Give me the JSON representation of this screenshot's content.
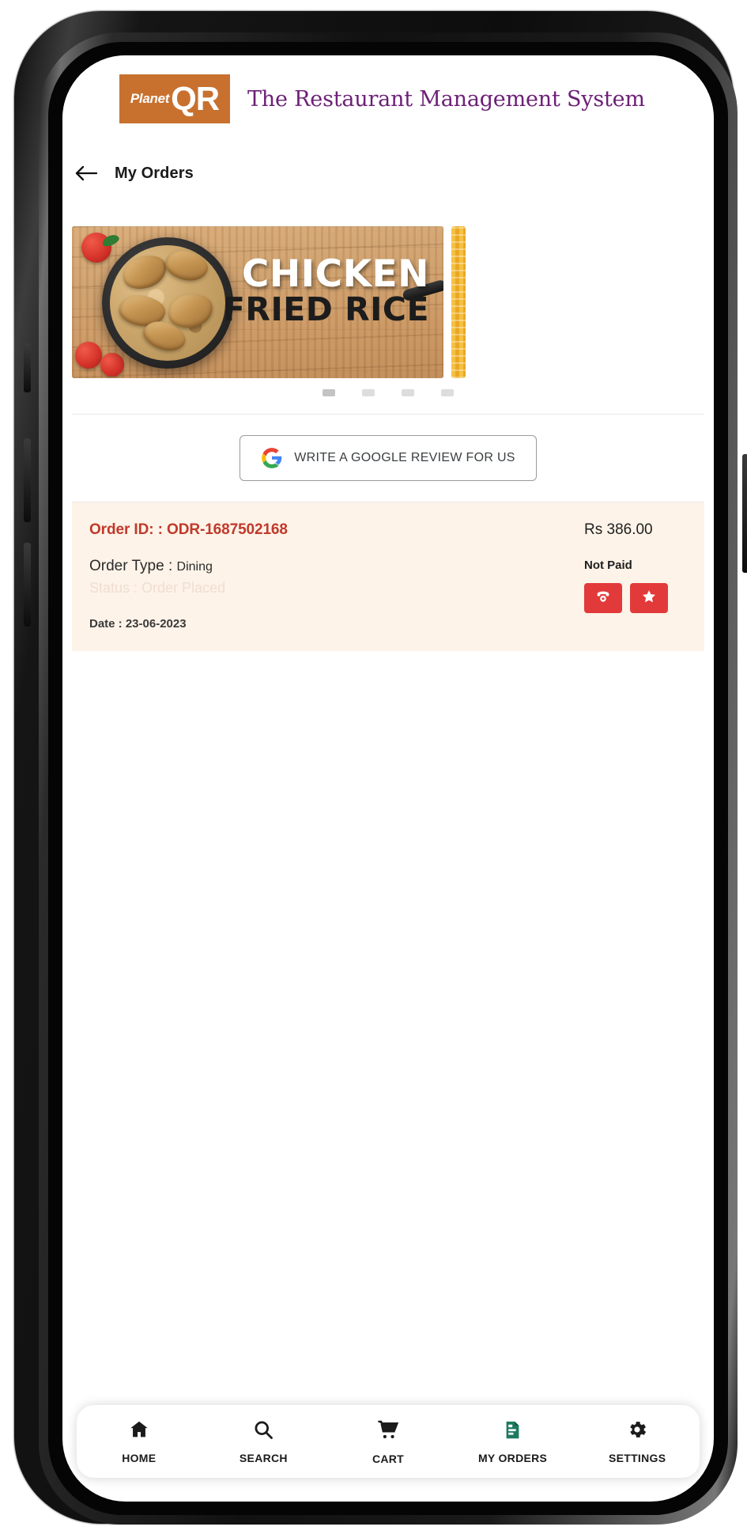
{
  "header": {
    "logo_planet": "Planet",
    "logo_qr": "QR",
    "title": "The Restaurant Management System",
    "logo_bg_color": "#c8712f",
    "title_color": "#6d2077"
  },
  "page": {
    "back_icon": "arrow-left-icon",
    "title": "My Orders"
  },
  "banner": {
    "line1": "CHICKEN",
    "line2": "FRIED RICE",
    "dots": 4,
    "active_dot_index": 0
  },
  "review": {
    "icon": "google-icon",
    "label": "WRITE A GOOGLE REVIEW FOR US"
  },
  "order": {
    "id_label": "Order ID: :",
    "id_value": "ODR-1687502168",
    "type_label": "Order Type :",
    "type_value": "Dining",
    "status_text": "Status : Order Placed",
    "date_text": "Date : 23-06-2023",
    "amount": "Rs 386.00",
    "payment_status": "Not Paid",
    "card_bg_color": "#fdf3e8",
    "id_color": "#c0392b",
    "action_color": "#e23a3a",
    "actions": [
      {
        "name": "call-button",
        "icon": "phone-icon"
      },
      {
        "name": "rate-button",
        "icon": "star-icon"
      }
    ]
  },
  "bottom_nav": {
    "active": "MY ORDERS",
    "active_color": "#1d7a5f",
    "items": [
      {
        "label": "HOME",
        "icon": "home-icon",
        "active": false
      },
      {
        "label": "SEARCH",
        "icon": "search-icon",
        "active": false
      },
      {
        "label": "CART",
        "icon": "cart-icon",
        "active": false
      },
      {
        "label": "MY ORDERS",
        "icon": "orders-receipt-icon",
        "active": true
      },
      {
        "label": "SETTINGS",
        "icon": "gear-icon",
        "active": false
      }
    ]
  }
}
